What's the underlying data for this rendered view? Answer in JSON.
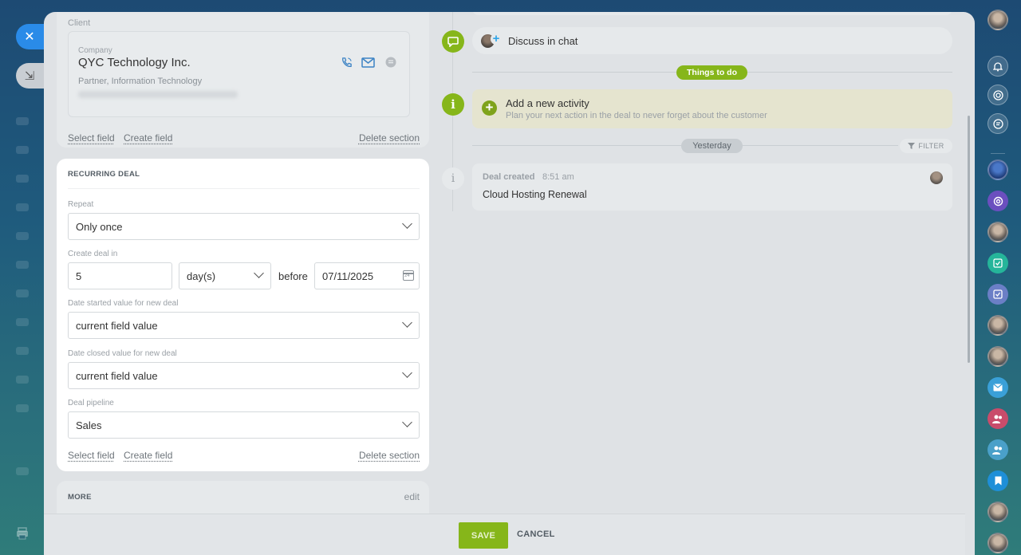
{
  "left_strip": {
    "close_glyph": "✕",
    "minimize_glyph": "⇲"
  },
  "client": {
    "section_label": "Client",
    "company_label": "Company",
    "company_name": "QYC Technology Inc.",
    "company_sub": "Partner, Information Technology",
    "links": {
      "select_field": "Select field",
      "create_field": "Create field",
      "delete_section": "Delete section"
    }
  },
  "recurring": {
    "title": "RECURRING DEAL",
    "repeat_label": "Repeat",
    "repeat_value": "Only once",
    "create_in_label": "Create deal in",
    "create_in_number": "5",
    "create_in_unit": "day(s)",
    "before_text": "before",
    "before_date": "07/11/2025",
    "date_started_label": "Date started value for new deal",
    "date_started_value": "current field value",
    "date_closed_label": "Date closed value for new deal",
    "date_closed_value": "current field value",
    "pipeline_label": "Deal pipeline",
    "pipeline_value": "Sales",
    "links": {
      "select_field": "Select field",
      "create_field": "Create field",
      "delete_section": "Delete section"
    }
  },
  "more": {
    "title": "MORE",
    "edit": "edit"
  },
  "timeline": {
    "discuss": "Discuss in chat",
    "things_to_do": "Things to do",
    "todo_title": "Add a new activity",
    "todo_sub": "Plan your next action in the deal to never forget about the customer",
    "yesterday": "Yesterday",
    "filter": "FILTER",
    "deal_created": "Deal created",
    "deal_time": "8:51 am",
    "deal_text": "Cloud Hosting Renewal"
  },
  "footer": {
    "save": "SAVE",
    "cancel": "CANCEL"
  },
  "colors": {
    "accent_green": "#86b61a",
    "blue": "#2a8be8",
    "todo_bg": "#e5e4cf"
  },
  "right_sidebar": {
    "icons": [
      "avatar",
      "bell-icon",
      "target-icon",
      "chat-icon",
      "avatar",
      "at-icon",
      "avatar",
      "check-icon",
      "check-icon",
      "avatar",
      "avatar",
      "mail-icon",
      "group-icon",
      "group-icon",
      "bookmark-icon",
      "avatar",
      "avatar"
    ]
  }
}
